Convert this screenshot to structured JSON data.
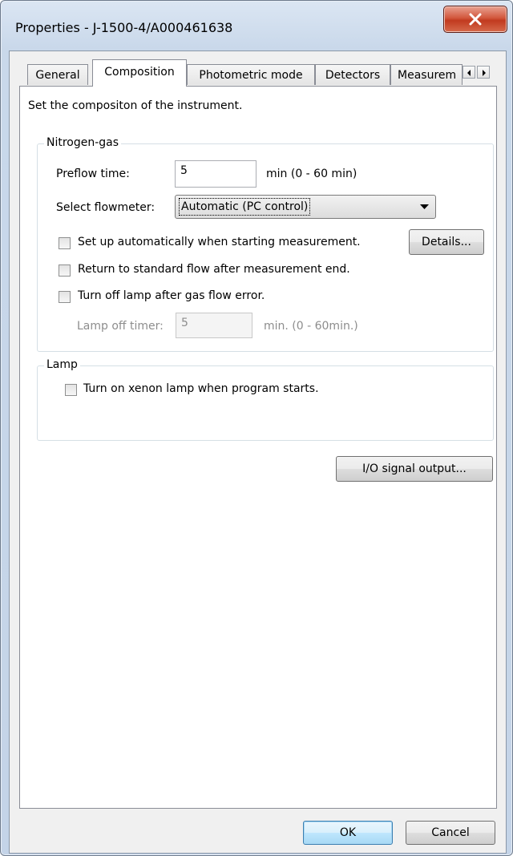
{
  "window": {
    "title": "Properties - J-1500-4/A000461638"
  },
  "tabs": [
    "General",
    "Composition",
    "Photometric mode",
    "Detectors",
    "Measurem"
  ],
  "active_tab": "Composition",
  "description": "Set the compositon of the instrument.",
  "nitrogen": {
    "group_title": "Nitrogen-gas",
    "preflow_label": "Preflow time:",
    "preflow_value": "5",
    "preflow_range": "min (0 - 60 min)",
    "flowmeter_label": "Select flowmeter:",
    "flowmeter_value": "Automatic (PC control)",
    "auto_setup_label": "Set up automatically when starting measurement.",
    "auto_setup_checked": false,
    "details_button": "Details...",
    "return_flow_label": "Return to standard flow after measurement end.",
    "return_flow_checked": false,
    "lamp_off_label": "Turn off lamp after gas flow error.",
    "lamp_off_checked": false,
    "lamp_timer_label": "Lamp off timer:",
    "lamp_timer_value": "5",
    "lamp_timer_range": "min. (0 - 60min.)"
  },
  "lamp": {
    "group_title": "Lamp",
    "xenon_label": "Turn on xenon lamp when program starts.",
    "xenon_checked": false
  },
  "io_button": "I/O signal output...",
  "ok_button": "OK",
  "cancel_button": "Cancel"
}
